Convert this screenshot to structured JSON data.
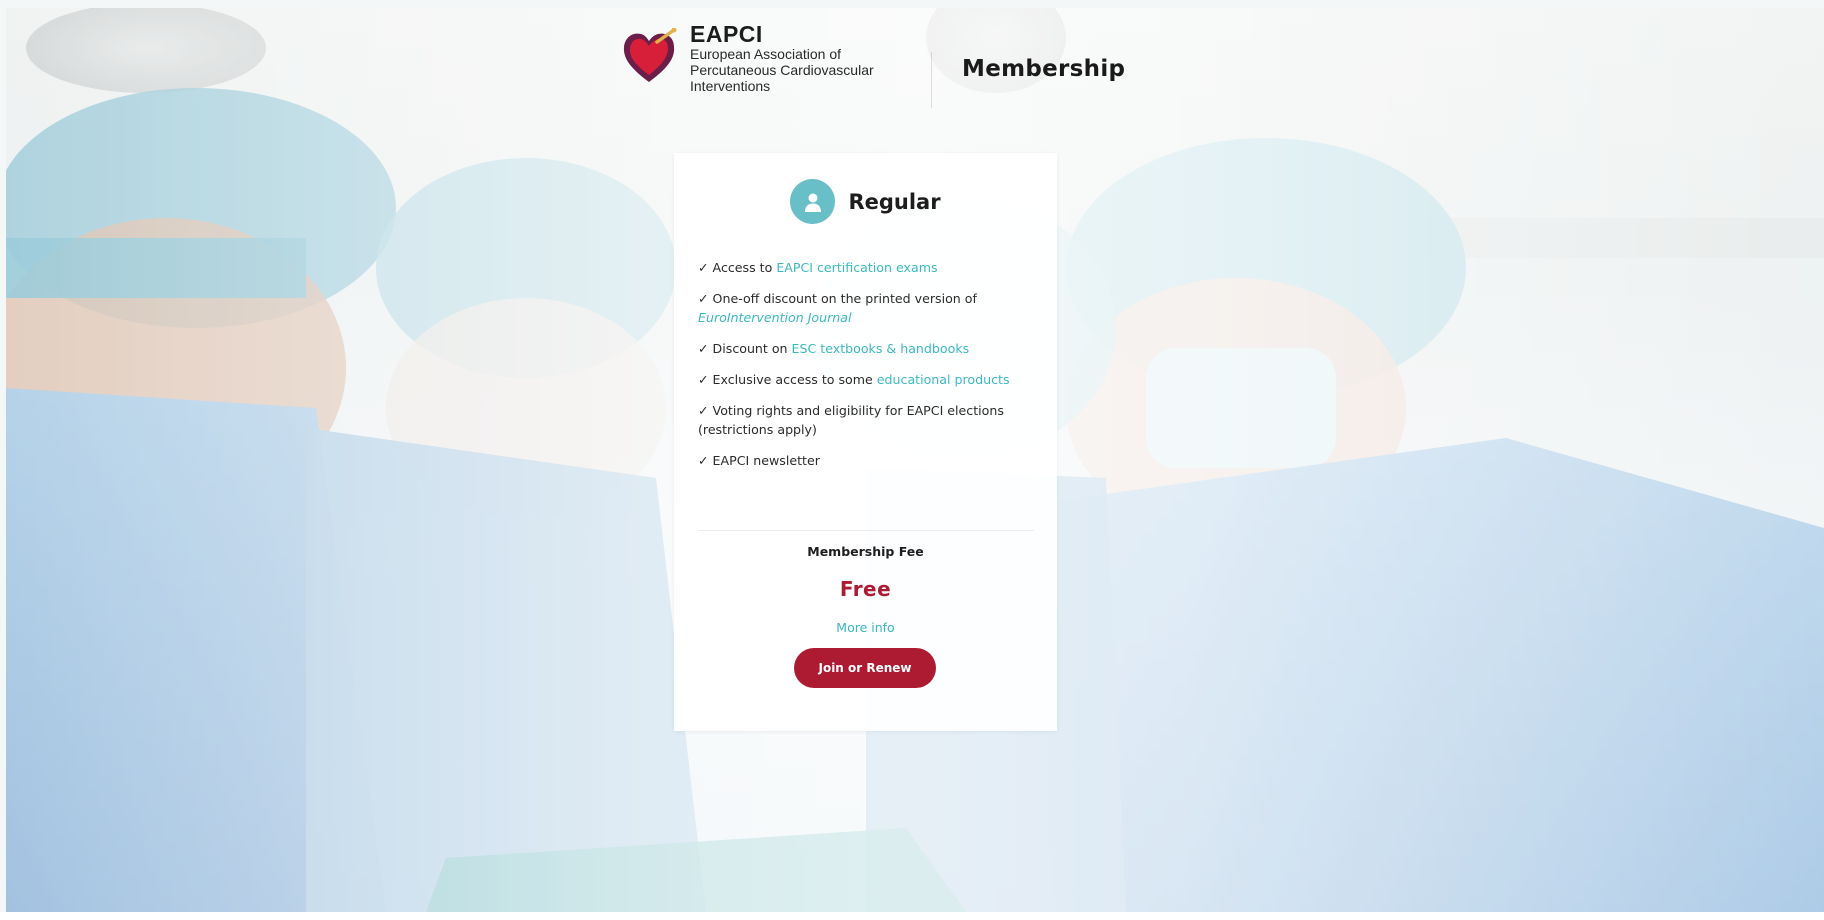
{
  "header": {
    "brand_name": "EAPCI",
    "brand_subtitle": "European Association of Percutaneous Cardiovascular Interventions",
    "section_title": "Membership"
  },
  "card": {
    "icon": "user-icon",
    "title": "Regular",
    "features": [
      {
        "prefix": "✓ Access to ",
        "link": "EAPCI certification exams",
        "suffix": ""
      },
      {
        "prefix": "✓ One-off discount on the printed version of ",
        "link": "EuroIntervention Journal",
        "suffix": ""
      },
      {
        "prefix": "✓ Discount on ",
        "link": "ESC textbooks & handbooks",
        "suffix": ""
      },
      {
        "prefix": "✓ Exclusive access to some ",
        "link": "educational products",
        "suffix": ""
      },
      {
        "prefix": "✓ Voting rights and eligibility for EAPCI elections (restrictions apply)",
        "link": "",
        "suffix": ""
      },
      {
        "prefix": "✓ EAPCI newsletter",
        "link": "",
        "suffix": ""
      }
    ],
    "fee_label": "Membership Fee",
    "fee_value": "Free",
    "more_info": "More info",
    "join_button": "Join or Renew"
  },
  "colors": {
    "accent_red": "#ad1b33",
    "accent_teal": "#3cb8c2",
    "badge_teal": "#69bfc7"
  }
}
